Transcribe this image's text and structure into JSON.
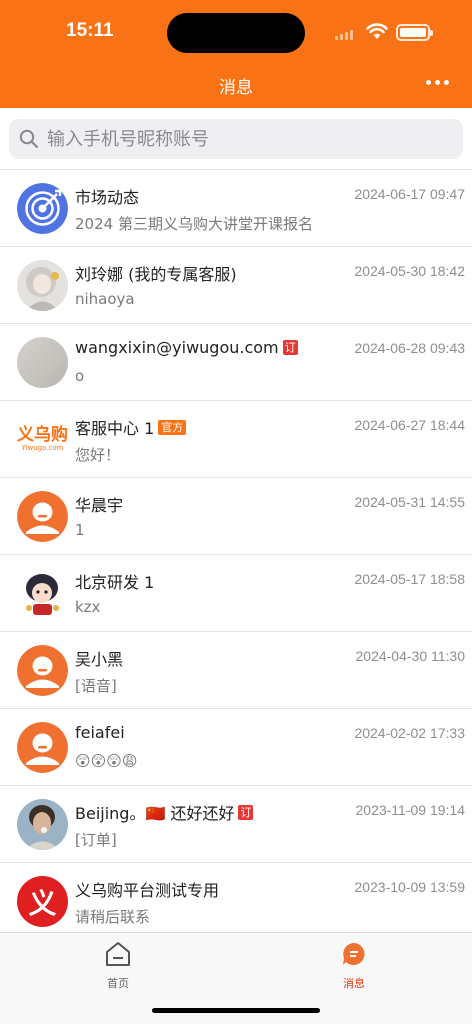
{
  "status_bar": {
    "time": "15:11"
  },
  "header": {
    "title": "消息"
  },
  "search": {
    "placeholder": "输入手机号昵称账号"
  },
  "conversations": [
    {
      "name": "市场动态",
      "time": "2024-06-17 09:47",
      "preview": "2024 第三期义乌购大讲堂开课报名",
      "avatar": "target-icon",
      "tag": ""
    },
    {
      "name": "刘玲娜 (我的专属客服)",
      "time": "2024-05-30 18:42",
      "preview": "nihaoya",
      "avatar": "photo-girl",
      "tag": ""
    },
    {
      "name": "wangxixin@yiwugou.com",
      "time": "2024-06-28 09:43",
      "preview": "o",
      "avatar": "photo-gray",
      "tag": "订"
    },
    {
      "name": "客服中心 1",
      "time": "2024-06-27 18:44",
      "preview": "您好！",
      "avatar": "yiwugo-logo",
      "tag": "官方",
      "logo_text": "义乌购",
      "logo_sub": "Yiwugo.com"
    },
    {
      "name": "华晨宇",
      "time": "2024-05-31 14:55",
      "preview": "1",
      "avatar": "default-user",
      "tag": ""
    },
    {
      "name": "北京研发 1",
      "time": "2024-05-17 18:58",
      "preview": "kzx",
      "avatar": "cartoon-girl",
      "tag": ""
    },
    {
      "name": "吴小黑",
      "time": "2024-04-30 11:30",
      "preview": "[语音]",
      "avatar": "default-user",
      "tag": ""
    },
    {
      "name": "feiafei",
      "time": "2024-02-02 17:33",
      "preview": "😲😲😲😩",
      "avatar": "default-user",
      "tag": ""
    },
    {
      "name": "Beijing。🇨🇳 还好还好",
      "time": "2023-11-09 19:14",
      "preview": "[订单]",
      "avatar": "photo-man",
      "tag": "订"
    },
    {
      "name": "义乌购平台测试专用",
      "time": "2023-10-09 13:59",
      "preview": "请稍后联系",
      "avatar": "yi-logo",
      "tag": "",
      "logo_text": "义"
    }
  ],
  "tabs": [
    {
      "label": "首页",
      "icon": "home-icon",
      "active": false
    },
    {
      "label": "消息",
      "icon": "message-icon",
      "active": true
    }
  ],
  "colors": {
    "brand": "#f97316",
    "tag_red": "#e53935",
    "active_tab": "#e8380d"
  }
}
